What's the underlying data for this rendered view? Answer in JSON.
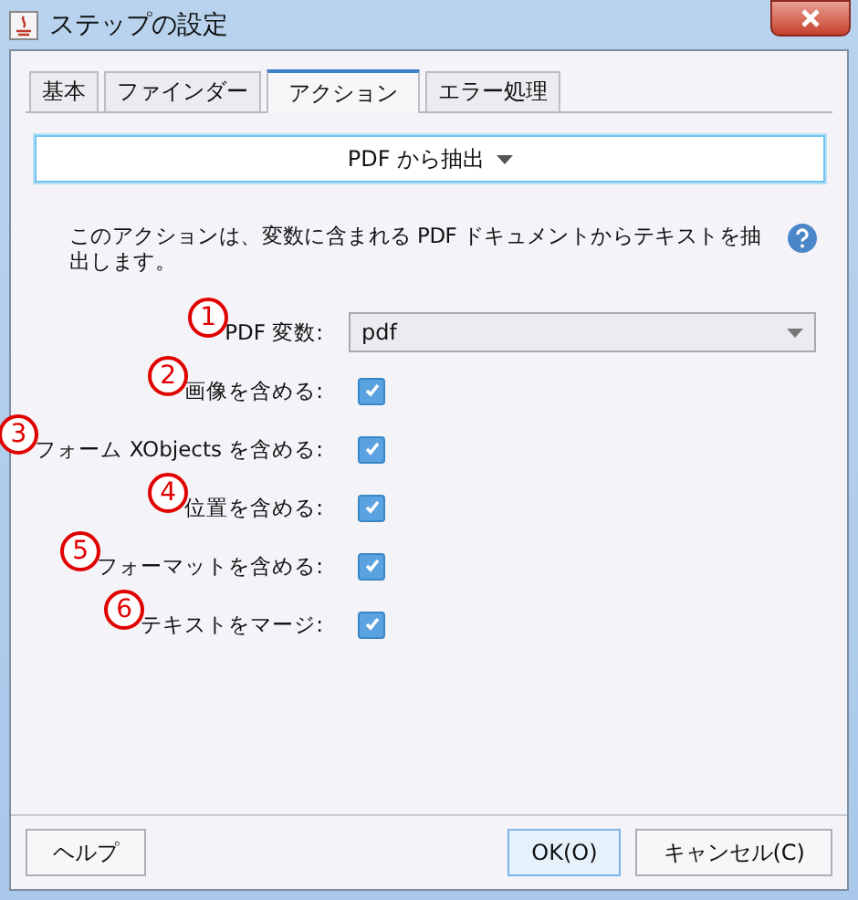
{
  "window": {
    "title": "ステップの設定"
  },
  "tabs": [
    {
      "label": "基本",
      "selected": false
    },
    {
      "label": "ファインダー",
      "selected": false
    },
    {
      "label": "アクション",
      "selected": true
    },
    {
      "label": "エラー処理",
      "selected": false
    }
  ],
  "action_button": {
    "label": "PDF から抽出"
  },
  "description": "このアクションは、変数に含まれる PDF ドキュメントからテキストを抽出します。",
  "fields": [
    {
      "kind": "combo",
      "label": "PDF 変数:",
      "value": "pdf",
      "annotation": "1"
    },
    {
      "kind": "checkbox",
      "label": "画像を含める:",
      "checked": true,
      "annotation": "2"
    },
    {
      "kind": "checkbox",
      "label": "フォーム XObjects を含める:",
      "checked": true,
      "annotation": "3"
    },
    {
      "kind": "checkbox",
      "label": "位置を含める:",
      "checked": true,
      "annotation": "4"
    },
    {
      "kind": "checkbox",
      "label": "フォーマットを含める:",
      "checked": true,
      "annotation": "5"
    },
    {
      "kind": "checkbox",
      "label": "テキストをマージ:",
      "checked": true,
      "annotation": "6"
    }
  ],
  "buttons": {
    "help": "ヘルプ",
    "ok": "OK(O)",
    "cancel": "キャンセル(C)"
  }
}
